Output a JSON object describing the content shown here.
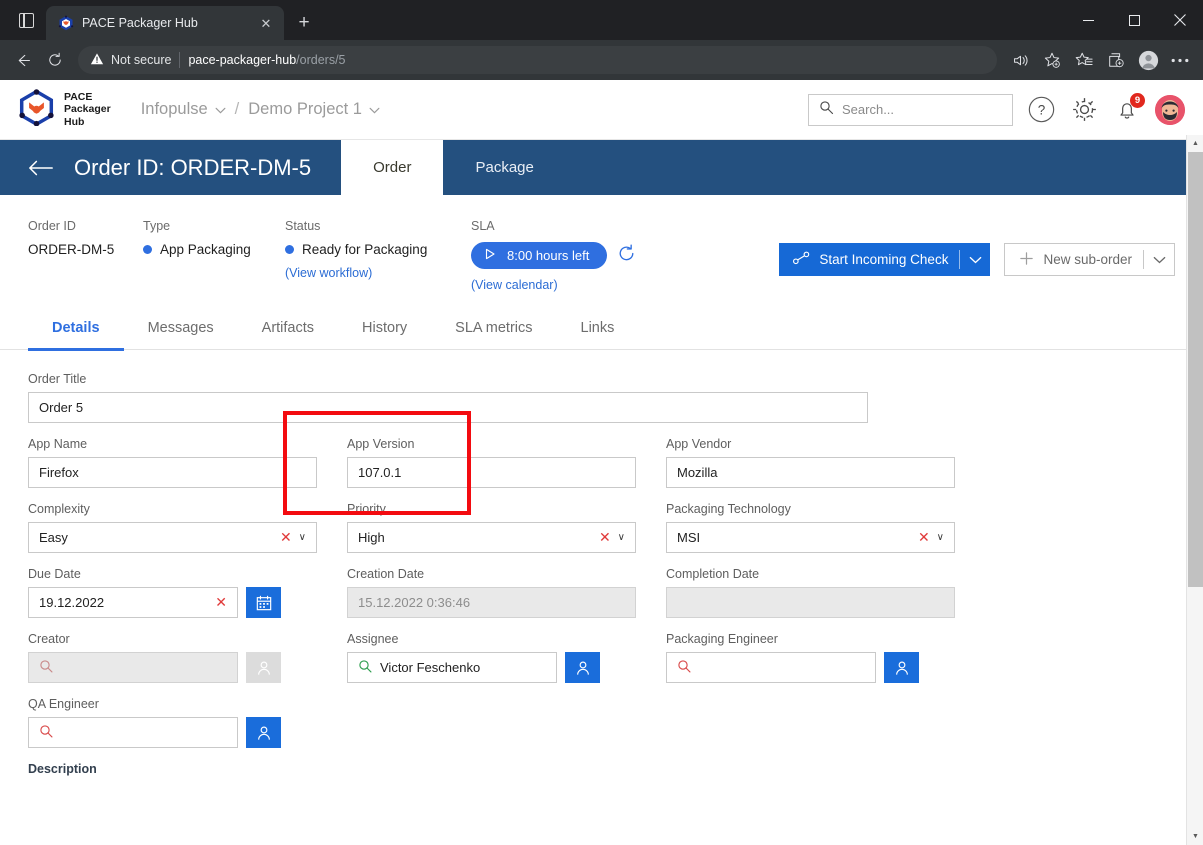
{
  "browser": {
    "tab": {
      "title": "PACE Packager Hub",
      "favicon": "pace-cube-icon",
      "close_label": "✕"
    },
    "new_tab_label": "+",
    "tab_list_icon": "tab-list-icon",
    "window": {
      "minimize": "—",
      "maximize": "□",
      "close": "✕"
    },
    "nav": {
      "back_icon": "back-arrow-icon",
      "reload_icon": "reload-icon",
      "security_label": "Not secure",
      "security_icon": "warning-triangle-icon",
      "url_host": "pace-packager-hub",
      "url_path": "/orders/5",
      "icons": [
        "read-aloud-icon",
        "add-favorite-icon",
        "favorites-icon",
        "collections-icon",
        "profile-icon",
        "settings-more-icon"
      ]
    }
  },
  "appheader": {
    "logo_line1": "PACE",
    "logo_line2": "Packager",
    "logo_line3": "Hub",
    "breadcrumb": [
      {
        "label": "Infopulse",
        "caret": "∨"
      },
      {
        "label": "Demo Project 1",
        "caret": "∨"
      }
    ],
    "separator": "/",
    "search": {
      "placeholder": "Search...",
      "icon": "search-icon"
    },
    "help_label": "?",
    "gear_icon": "gear-icon",
    "bell_icon": "bell-icon",
    "notification_count": "9",
    "avatar": "user-avatar"
  },
  "orderbar": {
    "back_icon": "back-arrow-icon",
    "title": "Order ID: ORDER-DM-5",
    "tabs": [
      {
        "label": "Order",
        "active": true
      },
      {
        "label": "Package",
        "active": false
      }
    ]
  },
  "meta": {
    "order_id": {
      "label": "Order ID",
      "value": "ORDER-DM-5"
    },
    "type": {
      "label": "Type",
      "value": "App Packaging",
      "dot_color": "#2f6fe0"
    },
    "status": {
      "label": "Status",
      "value": "Ready for Packaging",
      "dot_color": "#2f6fe0",
      "link": "(View workflow)",
      "highlight_color": "#f30b10"
    },
    "sla": {
      "label": "SLA",
      "pill_text": "8:00 hours left",
      "pill_icon": "play-icon",
      "refresh_icon": "refresh-icon",
      "link": "(View calendar)",
      "pill_color": "#2f6fe0"
    }
  },
  "actions": {
    "primary": {
      "label": "Start Incoming Check",
      "icon": "workflow-node-icon",
      "caret": "∨",
      "color": "#1669d6"
    },
    "secondary": {
      "label": "New sub-order",
      "icon": "plus-icon",
      "caret": "∨"
    }
  },
  "formtabs": [
    {
      "label": "Details",
      "active": true
    },
    {
      "label": "Messages",
      "active": false
    },
    {
      "label": "Artifacts",
      "active": false
    },
    {
      "label": "History",
      "active": false
    },
    {
      "label": "SLA metrics",
      "active": false
    },
    {
      "label": "Links",
      "active": false
    }
  ],
  "form": {
    "order_title": {
      "label": "Order Title",
      "value": "Order 5"
    },
    "app_name": {
      "label": "App Name",
      "value": "Firefox"
    },
    "app_version": {
      "label": "App Version",
      "value": "107.0.1"
    },
    "app_vendor": {
      "label": "App Vendor",
      "value": "Mozilla"
    },
    "complexity": {
      "label": "Complexity",
      "value": "Easy",
      "clear": "✕",
      "caret": "∨"
    },
    "priority": {
      "label": "Priority",
      "value": "High",
      "clear": "✕",
      "caret": "∨"
    },
    "packaging_technology": {
      "label": "Packaging Technology",
      "value": "MSI",
      "clear": "✕",
      "caret": "∨"
    },
    "due_date": {
      "label": "Due Date",
      "value": "19.12.2022",
      "clear": "✕",
      "button_icon": "calendar-icon"
    },
    "creation_date": {
      "label": "Creation Date",
      "value": "15.12.2022 0:36:46"
    },
    "completion_date": {
      "label": "Completion Date",
      "value": ""
    },
    "creator": {
      "label": "Creator",
      "value": "",
      "search_icon": "search-icon",
      "button_icon": "user-icon"
    },
    "assignee": {
      "label": "Assignee",
      "value": "Victor Feschenko",
      "search_icon": "search-icon",
      "button_icon": "user-icon"
    },
    "packaging_engineer": {
      "label": "Packaging Engineer",
      "value": "",
      "search_icon": "search-icon",
      "button_icon": "user-icon"
    },
    "qa_engineer": {
      "label": "QA Engineer",
      "value": "",
      "search_icon": "search-icon",
      "button_icon": "user-icon"
    },
    "description": {
      "label": "Description"
    }
  },
  "scrollbar": {
    "up": "▲",
    "down": "▼"
  }
}
